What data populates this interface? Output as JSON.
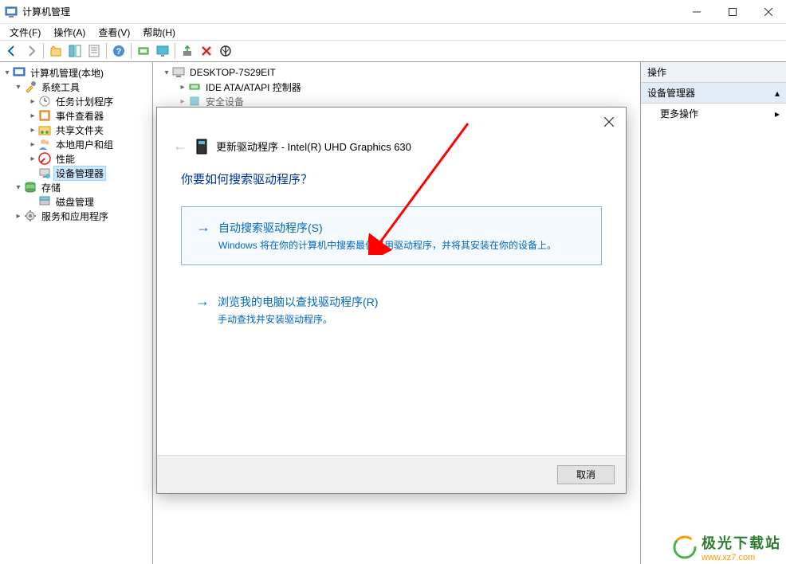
{
  "titlebar": {
    "title": "计算机管理"
  },
  "menubar": {
    "file": "文件(F)",
    "action": "操作(A)",
    "view": "查看(V)",
    "help": "帮助(H)"
  },
  "left_tree": {
    "root": "计算机管理(本地)",
    "system_tools": "系统工具",
    "task_scheduler": "任务计划程序",
    "event_viewer": "事件查看器",
    "shared_folders": "共享文件夹",
    "local_users": "本地用户和组",
    "performance": "性能",
    "device_manager": "设备管理器",
    "storage": "存储",
    "disk_mgmt": "磁盘管理",
    "services_apps": "服务和应用程序"
  },
  "center_tree": {
    "computer": "DESKTOP-7S29EIT",
    "ide": "IDE ATA/ATAPI 控制器",
    "security": "安全设备"
  },
  "right_pane": {
    "header": "操作",
    "section": "设备管理器",
    "more_actions": "更多操作"
  },
  "dialog": {
    "title": "更新驱动程序 - Intel(R) UHD Graphics 630",
    "prompt": "你要如何搜索驱动程序？",
    "option1_title": "自动搜索驱动程序(S)",
    "option1_desc": "Windows 将在你的计算机中搜索最佳可用驱动程序，并将其安装在你的设备上。",
    "option2_title": "浏览我的电脑以查找驱动程序(R)",
    "option2_desc": "手动查找并安装驱动程序。",
    "cancel": "取消"
  },
  "watermark": {
    "line1": "极光下载站",
    "line2": "www.xz7.com"
  }
}
